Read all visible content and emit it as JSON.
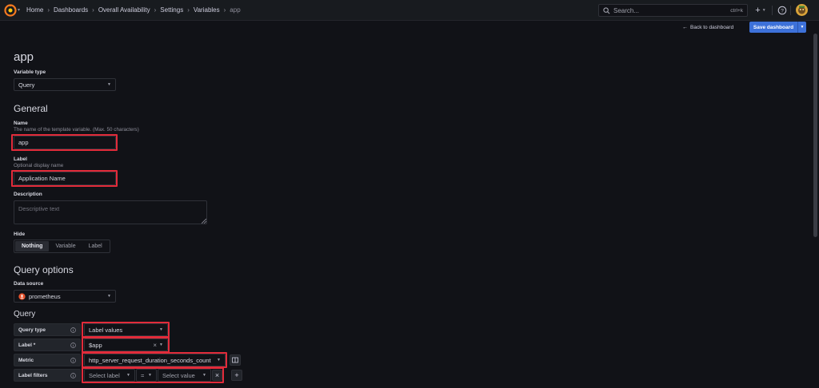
{
  "topbar": {
    "breadcrumb": [
      "Home",
      "Dashboards",
      "Overall Availability",
      "Settings",
      "Variables",
      "app"
    ],
    "search_placeholder": "Search...",
    "search_shortcut": "ctrl+k",
    "new_label": "+"
  },
  "toolbar": {
    "back_label": "Back to dashboard",
    "save_label": "Save dashboard"
  },
  "page": {
    "title": "app",
    "variable_type_label": "Variable type",
    "variable_type_value": "Query"
  },
  "general": {
    "heading": "General",
    "name_label": "Name",
    "name_desc": "The name of the template variable. (Max. 50 characters)",
    "name_value": "app",
    "label_label": "Label",
    "label_desc": "Optional display name",
    "label_value": "Application Name",
    "description_label": "Description",
    "description_placeholder": "Descriptive text",
    "hide_label": "Hide",
    "hide_options": [
      "Nothing",
      "Variable",
      "Label"
    ],
    "hide_selected": "Nothing"
  },
  "query_options": {
    "heading": "Query options",
    "datasource_label": "Data source",
    "datasource_value": "prometheus",
    "query_heading": "Query",
    "rows": {
      "query_type": {
        "label": "Query type",
        "value": "Label values"
      },
      "label": {
        "label": "Label *",
        "value": "$app"
      },
      "metric": {
        "label": "Metric",
        "value": "http_server_request_duration_seconds_count"
      },
      "label_filters": {
        "label": "Label filters",
        "select_label": "Select label",
        "operator": "=",
        "select_value": "Select value"
      }
    }
  },
  "colors": {
    "background": "#111217",
    "primary": "#3d71d9",
    "highlight": "#e22b3a"
  }
}
